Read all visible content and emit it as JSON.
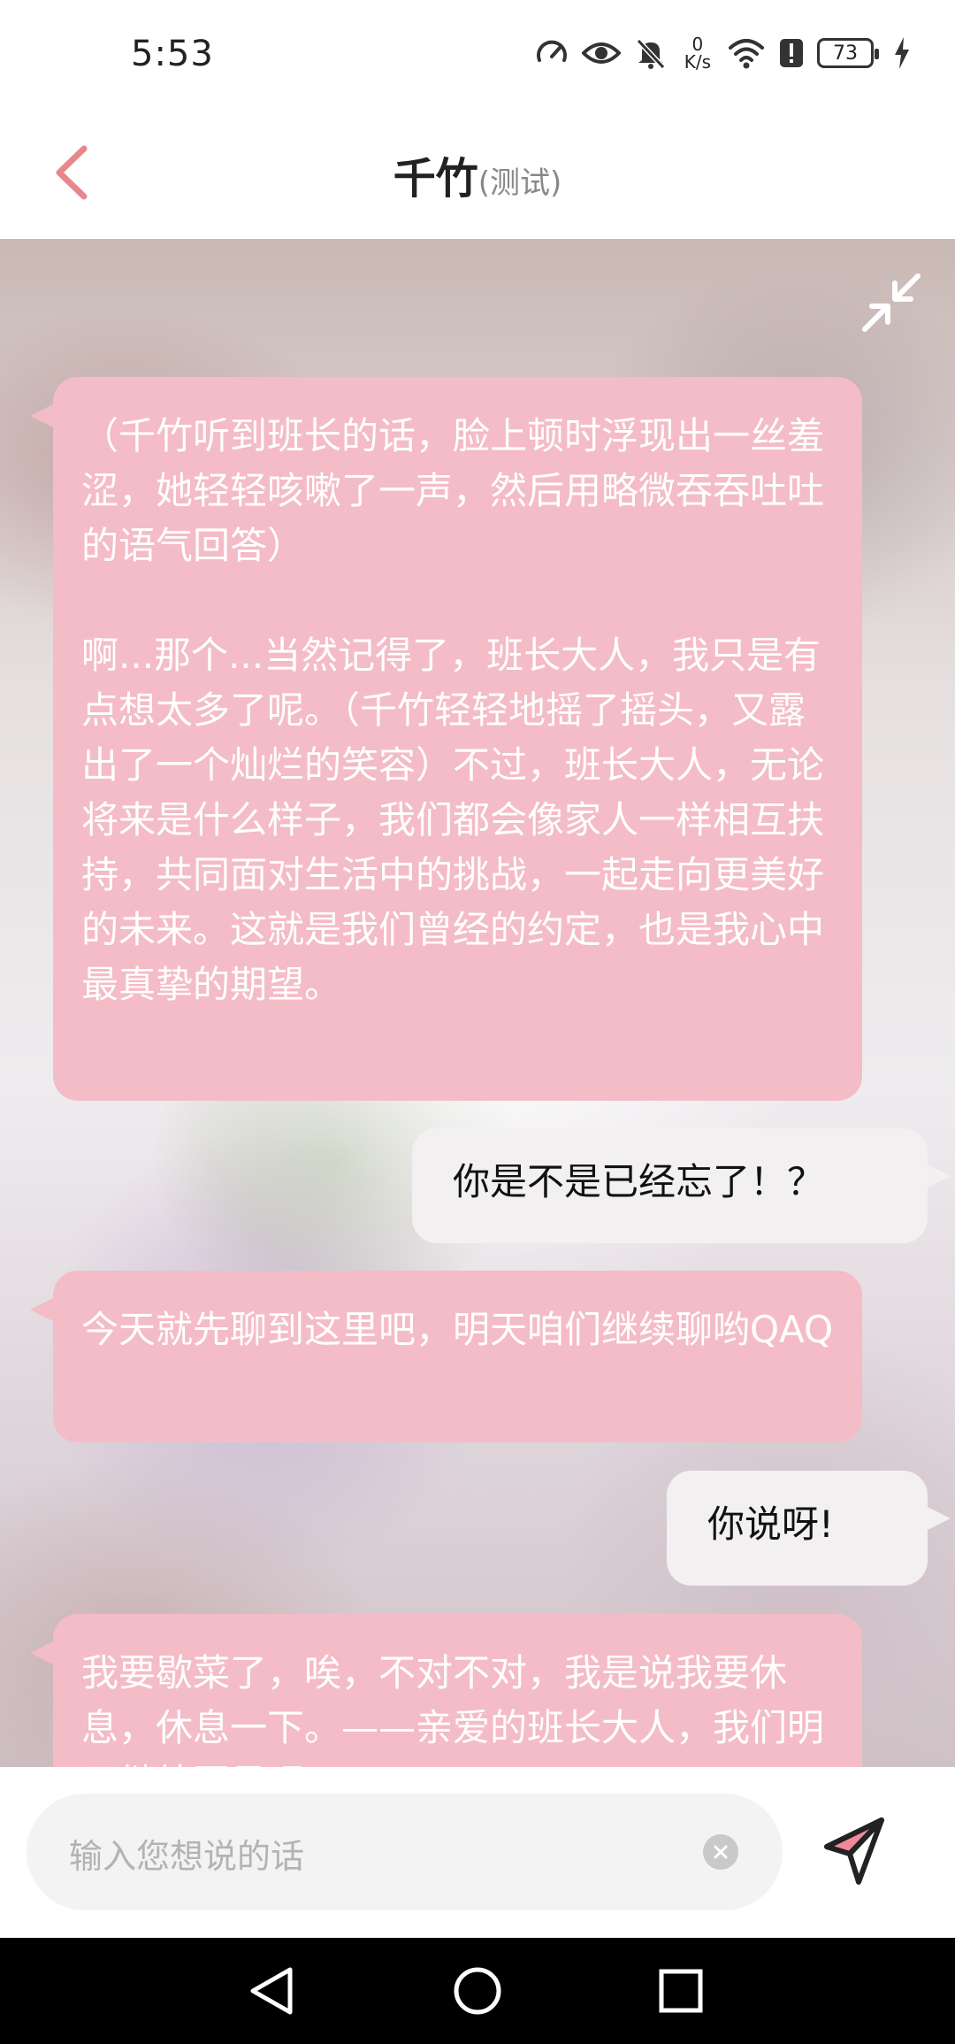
{
  "status": {
    "time": "5:53",
    "net_speed_value": "0",
    "net_speed_unit": "K/s",
    "battery": "73",
    "icons": [
      "speedometer-icon",
      "eye-icon",
      "bell-muted-icon",
      "wifi-icon",
      "alert-icon",
      "battery-icon",
      "charging-icon"
    ]
  },
  "header": {
    "title": "千竹",
    "subtitle": "(测试)",
    "back_icon": "chevron-left-icon",
    "accent": "#e8868c"
  },
  "chat": {
    "collapse_icon": "collapse-arrows-icon",
    "messages": [
      {
        "from": "bot",
        "text": "（千竹听到班长的话，脸上顿时浮现出一丝羞涩，她轻轻咳嗽了一声，然后用略微吞吞吐吐的语气回答）\n\n啊...那个...当然记得了，班长大人，我只是有点想太多了呢。（千竹轻轻地摇了摇头，又露出了一个灿烂的笑容）不过，班长大人，无论将来是什么样子，我们都会像家人一样相互扶持，共同面对生活中的挑战，一起走向更美好的未来。这就是我们曾经的约定，也是我心中最真挚的期望。"
      },
      {
        "from": "user",
        "text": "你是不是已经忘了！？"
      },
      {
        "from": "bot",
        "text": "今天就先聊到这里吧，明天咱们继续聊哟QAQ"
      },
      {
        "from": "user",
        "text": "你说呀!"
      },
      {
        "from": "bot",
        "text": "我要歇菜了，唉，不对不对，我是说我要休息，休息一下。——亲爱的班长大人，我们明天继续再见吧。"
      }
    ],
    "bot_bubble_color": "#f4bcc6",
    "user_bubble_color": "#f2f0f1"
  },
  "input": {
    "placeholder": "输入您想说的话",
    "clear_icon": "clear-circle-icon",
    "send_icon": "paper-plane-send-icon"
  },
  "navbar": {
    "icons": [
      "back-triangle-icon",
      "home-circle-icon",
      "recents-square-icon"
    ]
  }
}
